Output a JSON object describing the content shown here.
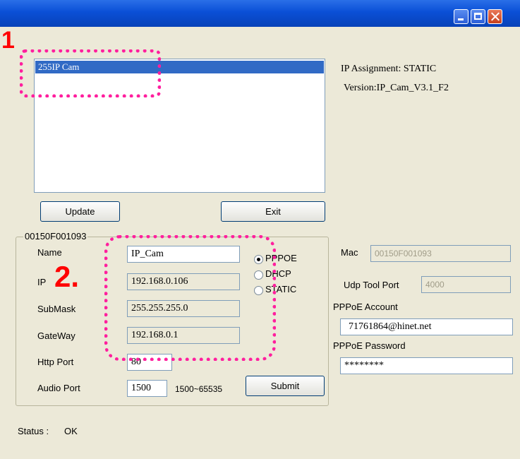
{
  "window": {
    "title": "",
    "controls": [
      "minimize-icon",
      "maximize-icon",
      "close-icon"
    ]
  },
  "device_list": {
    "items": [
      "255IP Cam"
    ]
  },
  "info": {
    "ip_assignment": "IP Assignment: STATIC",
    "version": "Version:IP_Cam_V3.1_F2"
  },
  "buttons": {
    "update": "Update",
    "exit": "Exit",
    "submit": "Submit"
  },
  "group": {
    "title": "00150F001093"
  },
  "form": {
    "name_label": "Name",
    "name_value": "IP_Cam",
    "ip_label": "IP",
    "ip_value": "192.168.0.106",
    "submask_label": "SubMask",
    "submask_value": "255.255.255.0",
    "gateway_label": "GateWay",
    "gateway_value": "192.168.0.1",
    "http_port_label": "Http Port",
    "http_port_value": "80",
    "audio_port_label": "Audio Port",
    "audio_port_value": "1500",
    "audio_port_range": "1500~65535"
  },
  "mode_options": {
    "pppoe": "PPPOE",
    "dhcp": "DHCP",
    "static": "STATIC",
    "selected": "PPPOE"
  },
  "right_panel": {
    "mac_label": "Mac",
    "mac_value": "00150F001093",
    "udp_label": "Udp Tool Port",
    "udp_value": "4000",
    "pppoe_account_label": "PPPoE Account",
    "pppoe_account_value": "71761864@hinet.net",
    "pppoe_password_label": "PPPoE Password",
    "pppoe_password_value": "********"
  },
  "status": {
    "label": "Status :",
    "value": "OK"
  },
  "annotations": {
    "step1": "1",
    "step2": "2.",
    "highlight_color": "#ff1f9e",
    "marker_color": "#ff0000"
  }
}
